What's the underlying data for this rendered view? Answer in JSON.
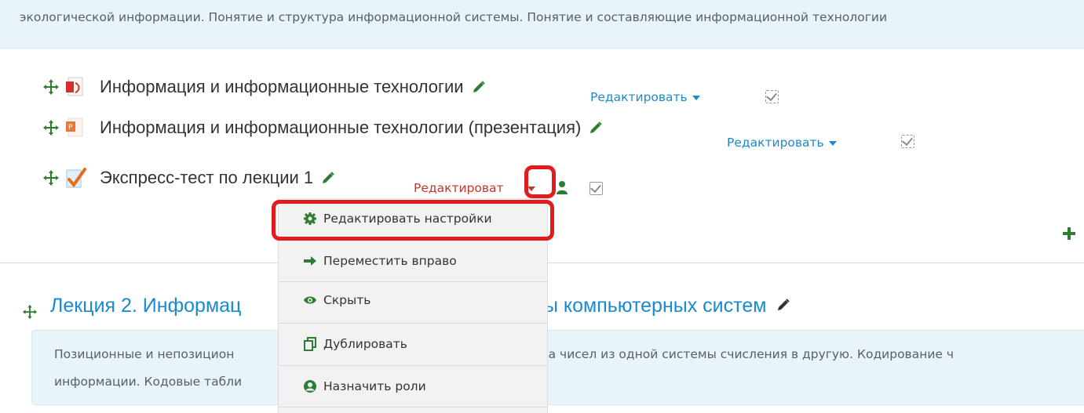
{
  "section1": {
    "description": "экологической информации. Понятие и структура информационной системы. Понятие и составляющие информационной технологии"
  },
  "activities": [
    {
      "title": "Информация и информационные технологии",
      "edit_label": "Редактировать",
      "icon": "pdf-icon"
    },
    {
      "title": "Информация и информационные технологии (презентация)",
      "edit_label": "Редактировать",
      "icon": "powerpoint-icon"
    },
    {
      "title": "Экспресс-тест по лекции 1",
      "edit_label": "Редактироват",
      "icon": "quiz-icon"
    }
  ],
  "menu": {
    "items": [
      {
        "label": "Редактировать настройки",
        "icon": "gear-icon"
      },
      {
        "label": "Переместить вправо",
        "icon": "arrow-right-icon"
      },
      {
        "label": "Скрыть",
        "icon": "eye-icon"
      },
      {
        "label": "Дублировать",
        "icon": "duplicate-icon"
      },
      {
        "label": "Назначить роли",
        "icon": "user-circle-icon"
      }
    ]
  },
  "section2": {
    "title_part1": "Лекция 2. Информац",
    "title_part2": "ы компьютерных систем",
    "desc_line1_part1": "Позиционные и непозицион",
    "desc_line1_part2": "еревода чисел из одной системы счисления в другую. Кодирование ч",
    "desc_line2": "информации. Кодовые табли"
  },
  "colors": {
    "accent": "#1a8ad0",
    "highlight": "#e21c1c",
    "icon_green": "#2e7d32",
    "edit_red": "#c0392b"
  }
}
